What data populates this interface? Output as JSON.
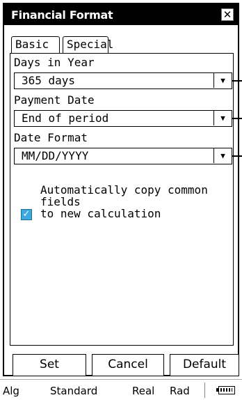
{
  "window": {
    "title": "Financial Format",
    "close_icon": "close-icon"
  },
  "tabs": [
    {
      "label": "Basic",
      "active": true
    },
    {
      "label": "Special",
      "active": false
    }
  ],
  "fields": {
    "days_in_year": {
      "label": "Days in Year",
      "value": "365 days"
    },
    "payment_date": {
      "label": "Payment Date",
      "value": "End of period"
    },
    "date_format": {
      "label": "Date Format",
      "value": "MM/DD/YYYY"
    }
  },
  "auto_copy": {
    "checked": true,
    "line1": "Automatically copy common fields",
    "line2": "to new calculation"
  },
  "buttons": {
    "set": "Set",
    "cancel": "Cancel",
    "default": "Default"
  },
  "status_bar": {
    "mode": "Alg",
    "display": "Standard",
    "number": "Real",
    "angle": "Rad",
    "battery_icon": "battery-icon"
  },
  "colors": {
    "checkbox": "#3ea8e0",
    "titlebar": "#000000"
  }
}
